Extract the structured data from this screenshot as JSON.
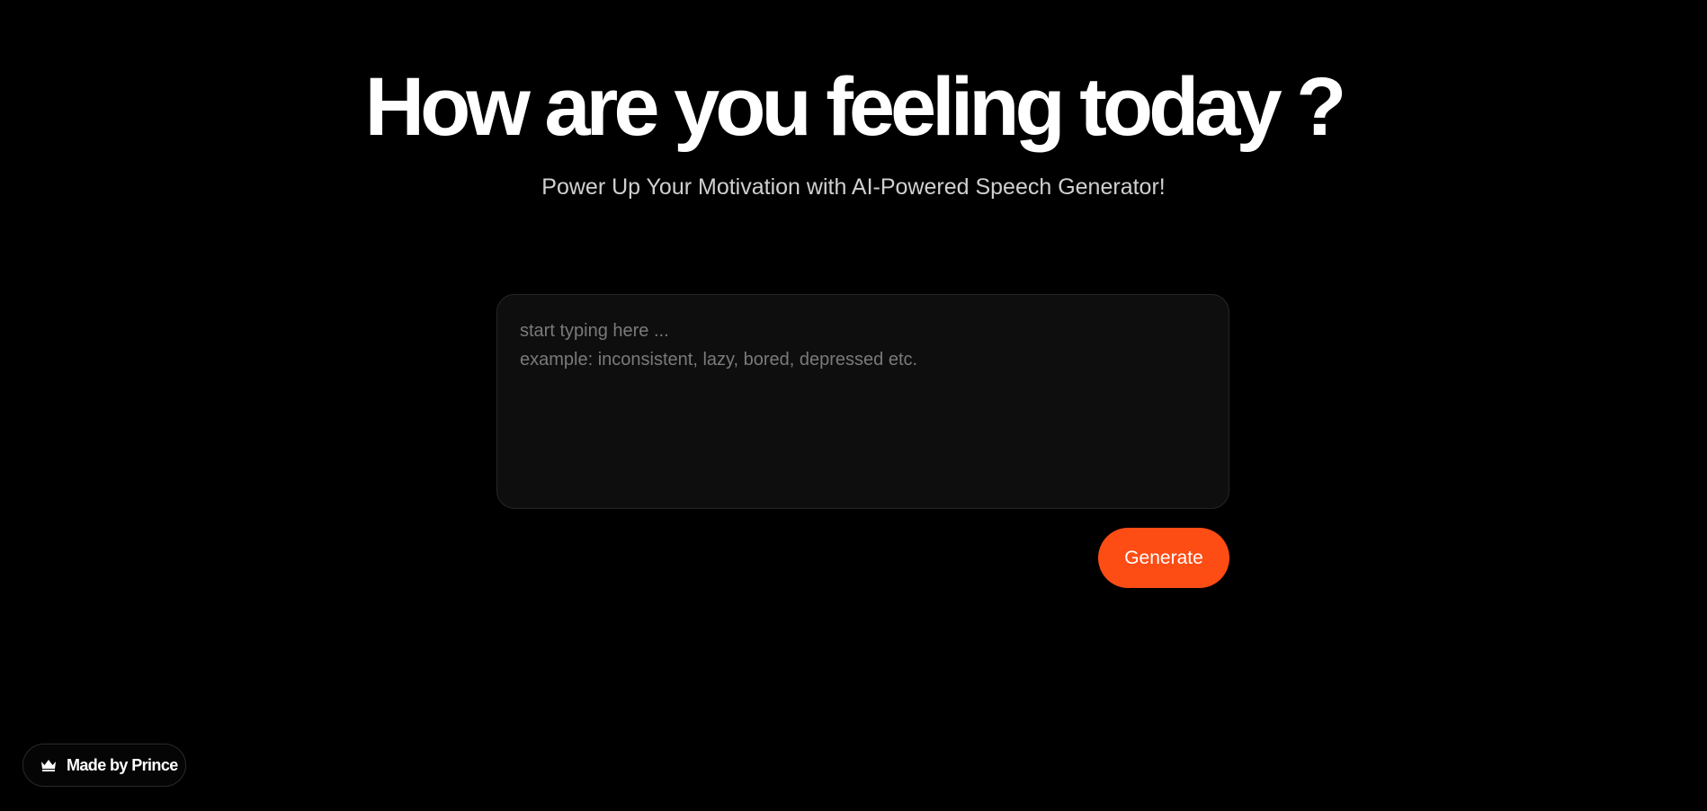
{
  "main": {
    "headline": "How are you feeling today ?",
    "subtitle": "Power Up Your Motivation with AI-Powered Speech Generator!",
    "input": {
      "placeholder_line1": "start typing here ...",
      "placeholder_line2": "example: inconsistent, lazy, bored, depressed etc.",
      "value": ""
    },
    "generate_label": "Generate"
  },
  "badge": {
    "label": "Made by Prince",
    "icon": "crown-icon"
  },
  "colors": {
    "background": "#000000",
    "accent": "#fd4c14",
    "input_background": "#0e0e0e"
  }
}
